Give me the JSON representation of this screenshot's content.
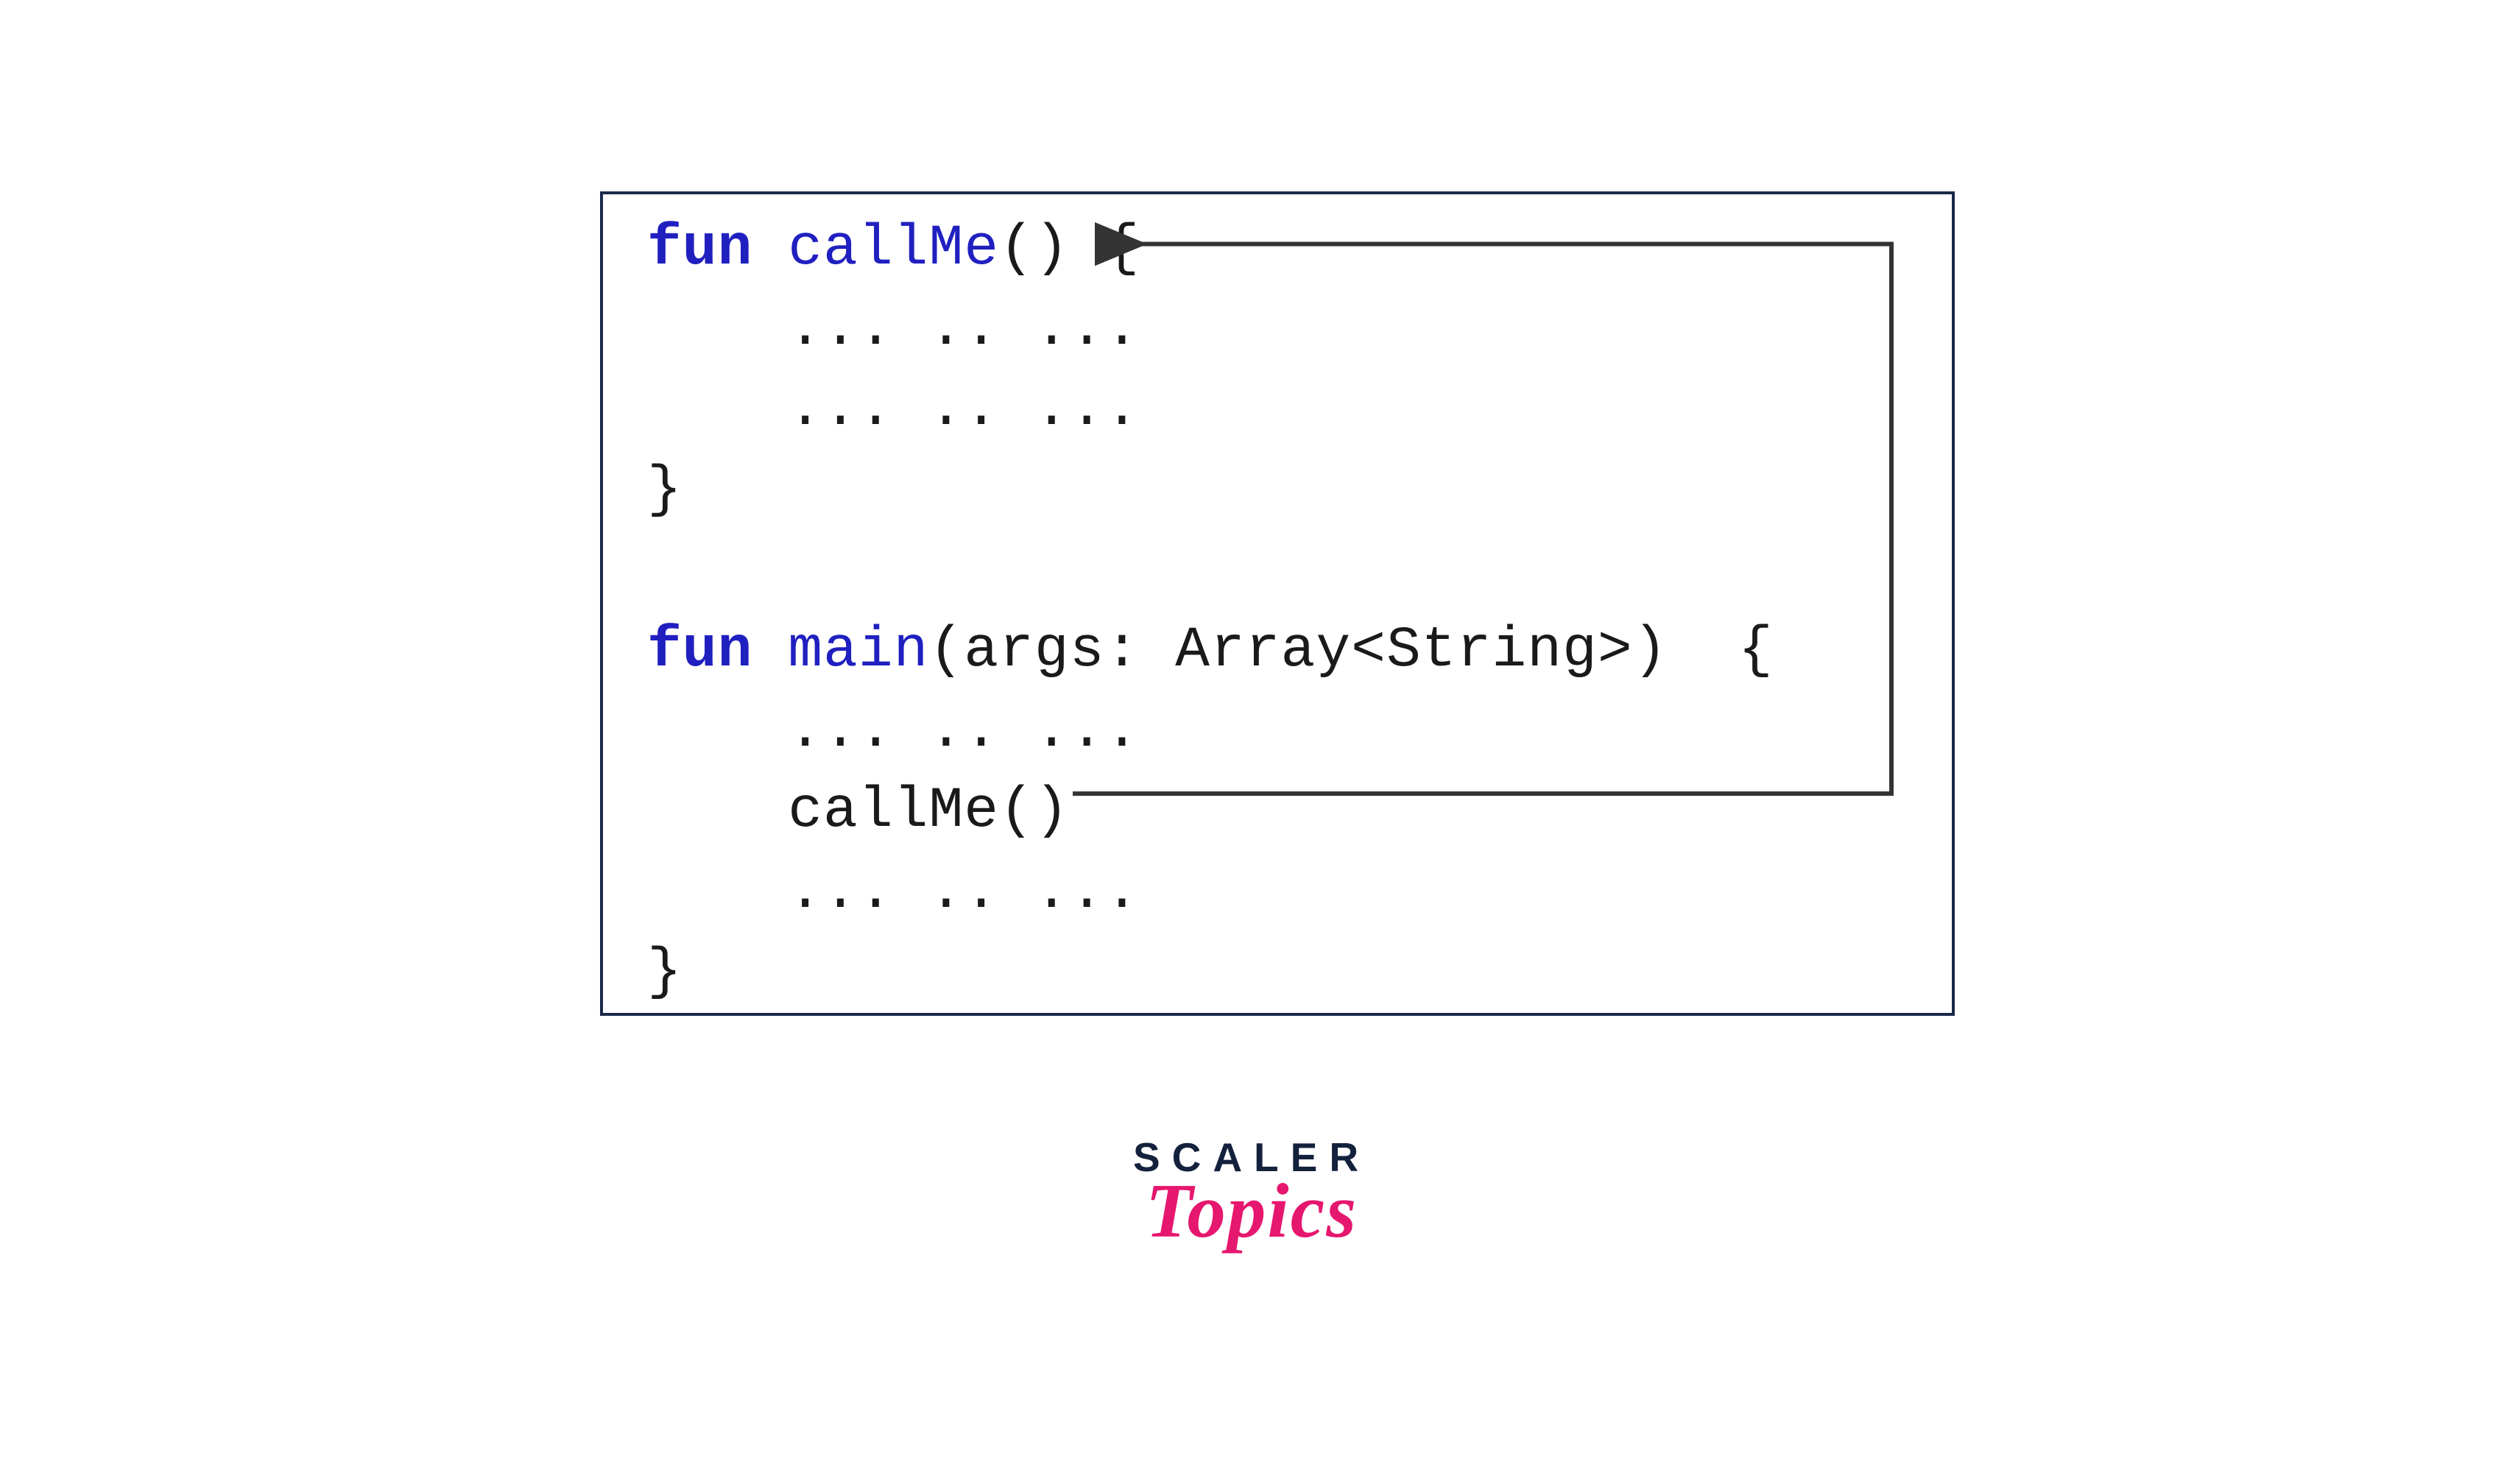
{
  "code": {
    "keyword1": "fun",
    "funcName1": "callMe",
    "parens1": "()",
    "brace1": " {",
    "dots1": "    ... .. ...",
    "dots2": "    ... .. ...",
    "closeBrace1": "}",
    "blank": " ",
    "keyword2": "fun",
    "funcName2": "main",
    "params": "(args: Array<String>)  {",
    "dots3": "    ... .. ...",
    "callLine": "    callMe()",
    "dots4": "    ... .. ...",
    "closeBrace2": "}"
  },
  "logo": {
    "line1": "SCALER",
    "line2": "Topics"
  },
  "arrow": {
    "from": "main.callMe()",
    "to": "fun callMe()"
  }
}
